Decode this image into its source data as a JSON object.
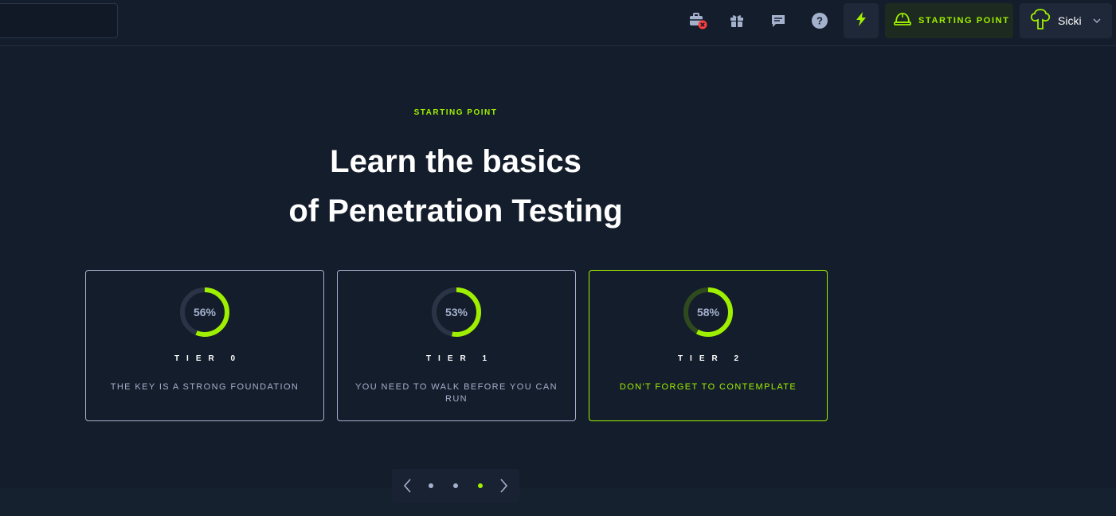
{
  "header": {
    "starting_point_label": "STARTING POINT",
    "user_name": "Sicki",
    "icons": [
      "briefcase-error-icon",
      "gift-icon",
      "chat-icon",
      "help-icon",
      "bolt-icon",
      "helmet-icon",
      "avatar-tree-icon",
      "chevron-down-icon"
    ]
  },
  "hero": {
    "kicker": "STARTING POINT",
    "title_line1": "Learn the basics",
    "title_line2": "of Penetration Testing"
  },
  "tiers": [
    {
      "percent": "56%",
      "progress": 0.56,
      "label": "TIER 0",
      "description": "THE KEY IS A STRONG FOUNDATION",
      "active": false
    },
    {
      "percent": "53%",
      "progress": 0.53,
      "label": "TIER 1",
      "description": "YOU NEED TO WALK BEFORE YOU CAN RUN",
      "active": false
    },
    {
      "percent": "58%",
      "progress": 0.58,
      "label": "TIER 2",
      "description": "DON'T FORGET TO CONTEMPLATE",
      "active": true
    }
  ],
  "pager": {
    "pages": 3,
    "active_index": 2
  },
  "colors": {
    "background": "#141d2b",
    "accent": "#9fef00",
    "muted": "#a4b1cd",
    "ring_track": "#2a3446"
  }
}
